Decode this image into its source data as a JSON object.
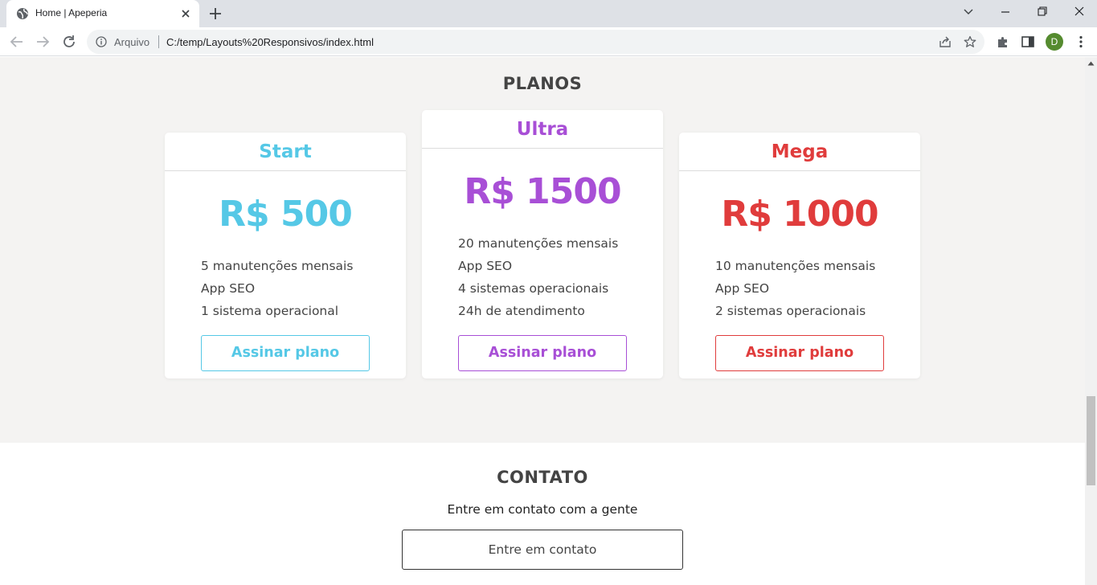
{
  "browser": {
    "tab_title": "Home | Apeperia",
    "scheme_label": "Arquivo",
    "url": "C:/temp/Layouts%20Responsivos/index.html",
    "profile_initial": "D"
  },
  "plans": {
    "title": "PLANOS",
    "cards": [
      {
        "name": "Start",
        "price": "R$ 500",
        "color": "#55c8e6",
        "features": [
          "5 manutenções mensais",
          "App SEO",
          "1 sistema operacional"
        ],
        "button": "Assinar plano"
      },
      {
        "name": "Ultra",
        "price": "R$ 1500",
        "color": "#a84fd6",
        "features": [
          "20 manutenções mensais",
          "App SEO",
          "4 sistemas operacionais",
          "24h de atendimento"
        ],
        "button": "Assinar plano"
      },
      {
        "name": "Mega",
        "price": "R$ 1000",
        "color": "#e03c3c",
        "features": [
          "10 manutenções mensais",
          "App SEO",
          "2 sistemas operacionais"
        ],
        "button": "Assinar plano"
      }
    ]
  },
  "contact": {
    "title": "CONTATO",
    "subtitle": "Entre em contato com a gente",
    "button": "Entre em contato"
  },
  "icons": [
    "globe-icon",
    "close-icon",
    "plus-icon",
    "chevron-down-icon",
    "minimize-icon",
    "restore-icon",
    "close-window-icon",
    "back-icon",
    "forward-icon",
    "reload-icon",
    "info-icon",
    "share-icon",
    "star-icon",
    "extensions-icon",
    "side-panel-icon",
    "menu-icon"
  ]
}
